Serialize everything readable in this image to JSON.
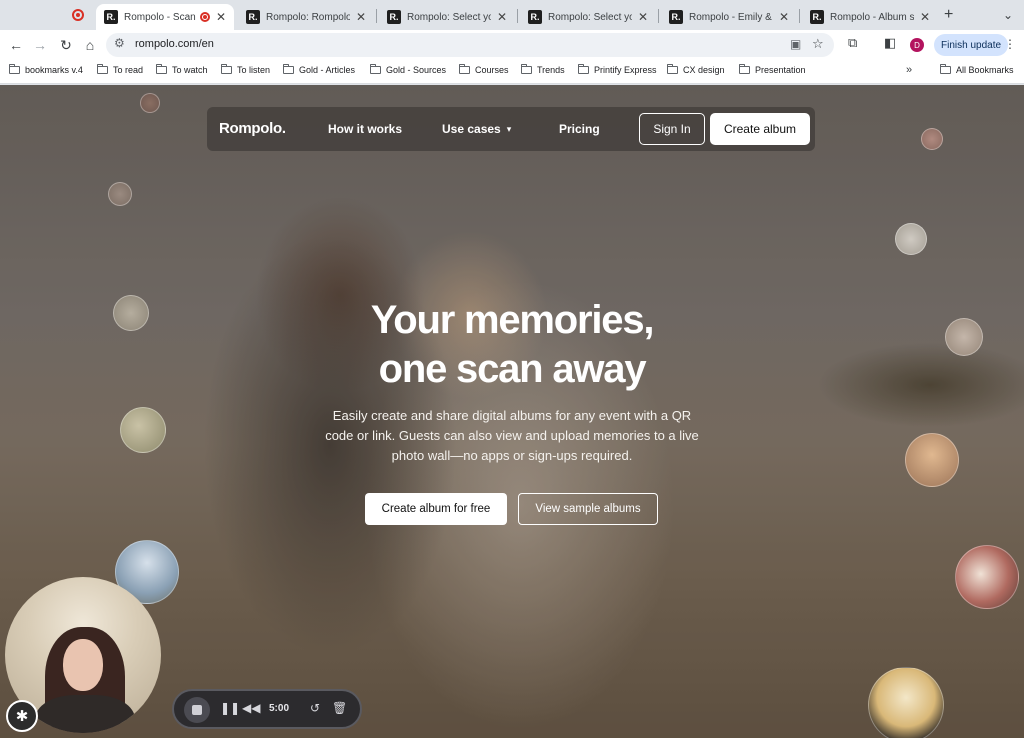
{
  "browser": {
    "tabs": [
      {
        "title": "Rompolo - Scan, Cr",
        "active": true
      },
      {
        "title": "Rompolo: Rompolo: Dig"
      },
      {
        "title": "Rompolo: Select your p"
      },
      {
        "title": "Rompolo: Select your p"
      },
      {
        "title": "Rompolo - Emily & Jon"
      },
      {
        "title": "Rompolo - Album settin"
      }
    ],
    "favicon_letter": "R.",
    "url": "rompolo.com/en",
    "profile_initial": "D",
    "update_label": "Finish update",
    "bookmarks": [
      "bookmarks v.4",
      "To read",
      "To watch",
      "To listen",
      "Gold - Articles",
      "Gold - Sources",
      "Courses",
      "Trends",
      "Printify Express",
      "CX design",
      "Presentation"
    ],
    "all_bookmarks": "All Bookmarks"
  },
  "site": {
    "logo": "Rompolo.",
    "nav": {
      "how_it_works": "How it works",
      "use_cases": "Use cases",
      "pricing": "Pricing",
      "sign_in": "Sign In",
      "create_album": "Create album"
    },
    "hero": {
      "headline_line1": "Your memories,",
      "headline_line2": "one scan away",
      "subtitle": "Easily create and share digital albums for any event with a QR code or link. Guests can also view and upload memories to a live photo wall—no apps or sign-ups required.",
      "cta_primary": "Create album for free",
      "cta_secondary": "View sample albums"
    }
  },
  "recorder": {
    "timer": "5:00"
  },
  "colors": {
    "profile": "#b3135e",
    "update_pill": "#d3e3fd",
    "record_red": "#d93025"
  }
}
